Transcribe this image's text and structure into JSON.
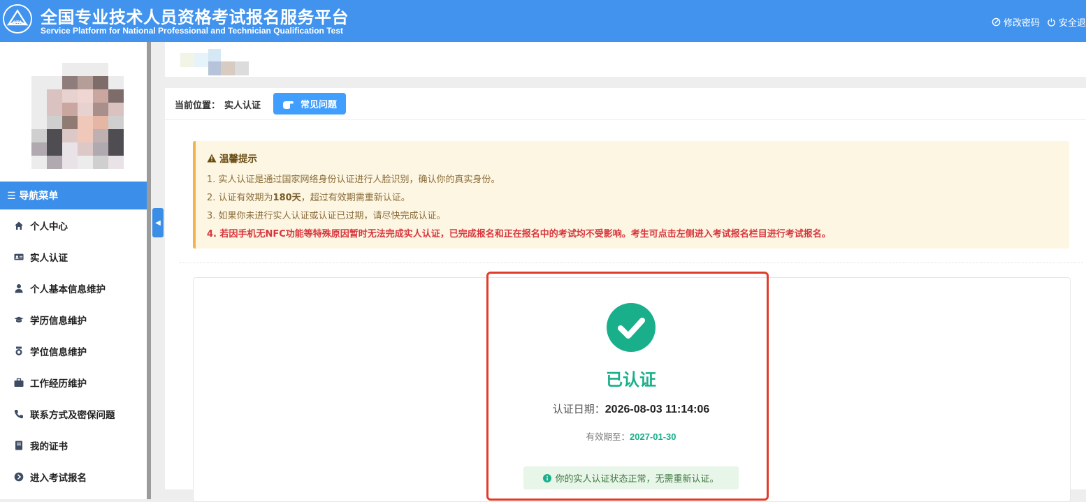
{
  "header": {
    "title_cn": "全国专业技术人员资格考试报名服务平台",
    "title_en": "Service Platform for National Professional and Technician Qualification Test",
    "logo_icon": "cpta-logo-icon",
    "change_password": "修改密码",
    "logout": "安全退"
  },
  "sidebar": {
    "nav_header": "☰ 导航菜单",
    "items": [
      {
        "label": "个人中心",
        "icon": "home-icon"
      },
      {
        "label": "实人认证",
        "icon": "id-card-icon"
      },
      {
        "label": "个人基本信息维护",
        "icon": "user-icon"
      },
      {
        "label": "学历信息维护",
        "icon": "graduation-cap-icon"
      },
      {
        "label": "学位信息维护",
        "icon": "medal-icon"
      },
      {
        "label": "工作经历维护",
        "icon": "briefcase-icon"
      },
      {
        "label": "联系方式及密保问题",
        "icon": "phone-icon"
      },
      {
        "label": "我的证书",
        "icon": "book-icon"
      },
      {
        "label": "进入考试报名",
        "icon": "arrow-circle-icon"
      }
    ]
  },
  "breadcrumb": {
    "prefix": "当前位置：",
    "current": "实人认证"
  },
  "faq_button": "常见问题",
  "notice": {
    "title": "温馨提示",
    "line1": "1. 实人认证是通过国家网络身份认证进行人脸识别，确认你的真实身份。",
    "line2_pre": "2. 认证有效期为",
    "line2_bold": "180天",
    "line2_post": "，超过有效期需重新认证。",
    "line3": "3. 如果你未进行实人认证或认证已过期，请尽快完成认证。",
    "line4": "4. 若因手机无NFC功能等特殊原因暂时无法完成实人认证，已完成报名和正在报名中的考试均不受影响。考生可点击左侧进入考试报名栏目进行考试报名。"
  },
  "status": {
    "title": "已认证",
    "date_label": "认证日期：",
    "date_value": "2026-08-03 11:14:06",
    "valid_label": "有效期至：",
    "valid_value": "2027-01-30",
    "note": "你的实人认证状态正常，无需重新认证。"
  },
  "colors": {
    "header_bg": "#4193ee",
    "nav_header_bg": "#3b8fea",
    "success": "#1aaf8b",
    "highlight_border": "#e03c2a",
    "notice_bg": "#fdf6e2",
    "warn_text": "#d9363e"
  }
}
